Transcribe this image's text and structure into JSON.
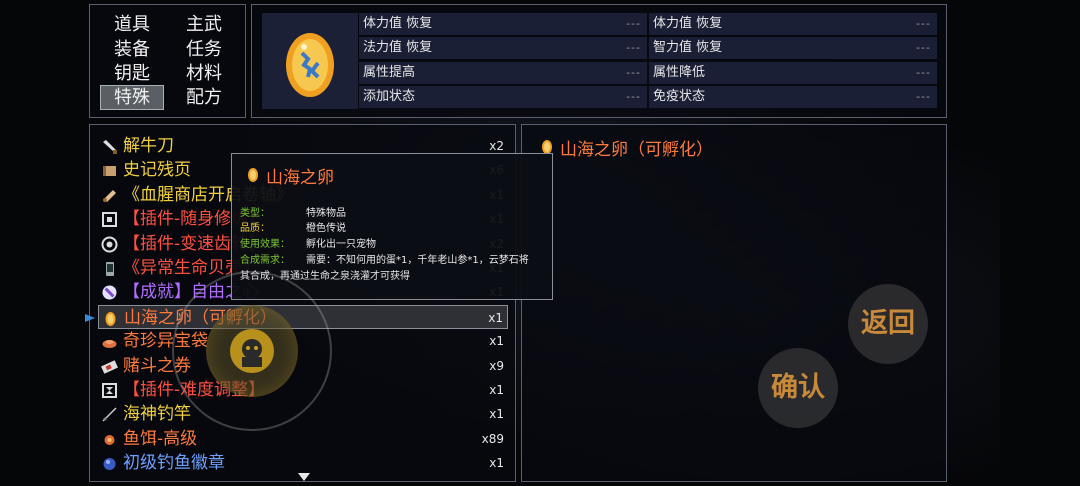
{
  "categories": [
    {
      "label": "道具",
      "active": false
    },
    {
      "label": "主武",
      "active": false
    },
    {
      "label": "装备",
      "active": false
    },
    {
      "label": "任务",
      "active": false
    },
    {
      "label": "钥匙",
      "active": false
    },
    {
      "label": "材料",
      "active": false
    },
    {
      "label": "特殊",
      "active": true
    },
    {
      "label": "配方",
      "active": false
    }
  ],
  "stats": [
    {
      "label": "体力值 恢复",
      "value": "---"
    },
    {
      "label": "体力值 恢复",
      "value": "---"
    },
    {
      "label": "法力值 恢复",
      "value": "---"
    },
    {
      "label": "智力值 恢复",
      "value": "---"
    },
    {
      "label": "属性提高",
      "value": "---"
    },
    {
      "label": "属性降低",
      "value": "---"
    },
    {
      "label": "添加状态",
      "value": "---"
    },
    {
      "label": "免疫状态",
      "value": "---"
    }
  ],
  "items": [
    {
      "name": "解牛刀",
      "qty": "x2",
      "color": "#f0d040",
      "icon": "knife-icon"
    },
    {
      "name": "史记残页",
      "qty": "x6",
      "color": "#f0d040",
      "icon": "scroll-page-icon"
    },
    {
      "name": "《血腥商店开启卷轴》",
      "qty": "x1",
      "color": "#f0d040",
      "icon": "scroll-icon"
    },
    {
      "name": "【插件-随身修炼】",
      "qty": "x1",
      "color": "#ff5040",
      "icon": "chip-icon"
    },
    {
      "name": "【插件-变速齿轮】",
      "qty": "x2",
      "color": "#ff5040",
      "icon": "gear-icon"
    },
    {
      "name": "《异常生命贝壳》",
      "qty": "x1",
      "color": "#ff5040",
      "icon": "phone-icon"
    },
    {
      "name": "【成就】自由之心",
      "qty": "x1",
      "color": "#b06cff",
      "icon": "no-entry-icon"
    },
    {
      "name": "山海之卵（可孵化）",
      "qty": "x1",
      "color": "#ff7a3c",
      "icon": "egg-icon",
      "selected": true
    },
    {
      "name": "奇珍异宝袋",
      "qty": "x1",
      "color": "#ff7a3c",
      "icon": "bag-icon"
    },
    {
      "name": "赌斗之券",
      "qty": "x9",
      "color": "#ff7a3c",
      "icon": "ticket-icon"
    },
    {
      "name": "【插件-难度调整】",
      "qty": "x1",
      "color": "#ff5040",
      "icon": "hourglass-icon"
    },
    {
      "name": "海神钓竿",
      "qty": "x1",
      "color": "#f0d040",
      "icon": "fishing-rod-icon"
    },
    {
      "name": "鱼饵-高级",
      "qty": "x89",
      "color": "#ff7a3c",
      "icon": "bait-icon"
    },
    {
      "name": "初级钓鱼徽章",
      "qty": "x1",
      "color": "#6ea0ff",
      "icon": "badge-icon"
    }
  ],
  "detail": {
    "title": "山海之卵（可孵化）"
  },
  "tooltip": {
    "title": "山海之卵",
    "type_label": "类型：",
    "type_value": "特殊物品",
    "quality_label": "品质：",
    "quality_value": "橙色传说",
    "effect_label": "使用效果：",
    "effect_value": "孵化出一只宠物",
    "recipe_label": "合成需求：",
    "recipe_line1": "需要：不知何用的蛋*1，千年老山参*1，云梦石将",
    "recipe_line2": "其合成，再通过生命之泉浇灌才可获得"
  },
  "buttons": {
    "return_label": "返回",
    "confirm_label": "确认"
  }
}
